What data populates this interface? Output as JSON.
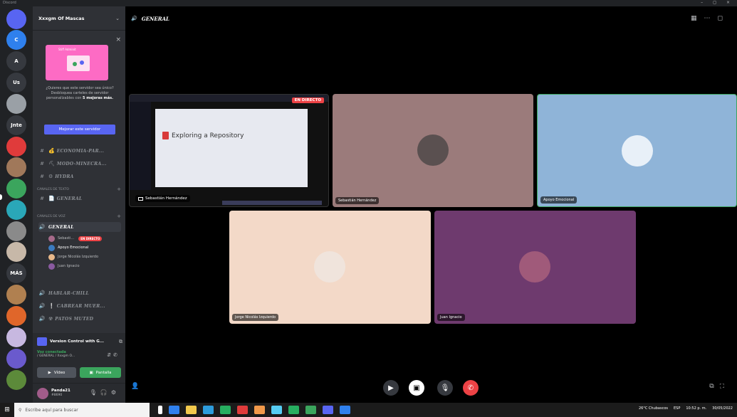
{
  "window": {
    "app_title": "Discord",
    "controls": "– ◻ ×"
  },
  "server_rail": {
    "items": [
      {
        "label": "",
        "color": "#5865f2"
      },
      {
        "label": "C",
        "color": "#2f80ed"
      },
      {
        "label": "A",
        "color": "#36393f"
      },
      {
        "label": "Us",
        "color": "#36393f"
      },
      {
        "label": "",
        "color": "#9aa0a6"
      },
      {
        "label": "Jnte",
        "color": "#36393f"
      },
      {
        "label": "",
        "color": "#e03b3b"
      },
      {
        "label": "",
        "color": "#a0785a"
      },
      {
        "label": "",
        "color": "#3ba55d"
      },
      {
        "label": "",
        "color": "#2aa7b8"
      },
      {
        "label": "",
        "color": "#8a8a8a"
      },
      {
        "label": "",
        "color": "#c7b8a8"
      },
      {
        "label": "MÁS",
        "color": "#36393f"
      },
      {
        "label": "",
        "color": "#b08050"
      },
      {
        "label": "",
        "color": "#e0662a"
      },
      {
        "label": "",
        "color": "#c7b8e0"
      },
      {
        "label": "",
        "color": "#6a5acd"
      },
      {
        "label": "",
        "color": "#5c8a3a"
      }
    ]
  },
  "sidebar": {
    "server_name": "Xxxgm Of Mascas",
    "promo": {
      "card_label": "Stiff Adminit",
      "text_pre": "¿Quieres que este servidor sea único? Desbloquea carteles de servidor personalizables con",
      "text_bold": "5 mejoras más.",
      "button": "Mejorar este servidor"
    },
    "channels_top": [
      {
        "icon": "#",
        "emoji": "💰",
        "label": "ECONOMIA-PAR..."
      },
      {
        "icon": "#",
        "emoji": "⛏",
        "label": "MODO-MINECRA..."
      },
      {
        "icon": "#",
        "emoji": "⚙",
        "label": "HYDRA"
      }
    ],
    "cat_text": "CANALES DE TEXTO",
    "text_channel": {
      "icon": "#",
      "emoji": "📄",
      "label": "GENERAL"
    },
    "cat_voice": "CANALES DE VOZ",
    "voice_general": "GENERAL",
    "voice_users": [
      {
        "name": "Sebasti...",
        "live": "EN DIRECTO",
        "color": "#a66a8a"
      },
      {
        "name": "Apoyo Emocional",
        "live": "",
        "color": "#3b7bbf"
      },
      {
        "name": "Jorge Nicolás Izquierdo",
        "live": "",
        "color": "#e8b88a"
      },
      {
        "name": "Juan Ignacio",
        "live": "",
        "color": "#8a5aa0"
      }
    ],
    "voice_others": [
      {
        "label": "HABLAR-CHILL",
        "emoji": ""
      },
      {
        "label": "CABREAR MUER...",
        "emoji": "❕"
      },
      {
        "label": "PATOS MUTED",
        "emoji": "☢"
      }
    ]
  },
  "stream_panel": {
    "title": "Version Control with G...",
    "status": "Voz conectada",
    "path": "/ GENERAL / Xxxgm O...",
    "video": "Vídeo",
    "screen": "Pantalla"
  },
  "user_panel": {
    "name": "Panda21",
    "tag": "#8690"
  },
  "main": {
    "channel_title": "GENERAL",
    "tiles": {
      "stream": {
        "live": "EN DIRECTO",
        "slide_title": "Exploring a Repository",
        "name": "Sebastián Hernández"
      },
      "sebastian": {
        "name": "Sebastián Hernández",
        "bg": "#9b7b7b"
      },
      "apoyo": {
        "name": "Apoyo Emocional",
        "bg": "#8fb4d8"
      },
      "jorge": {
        "name": "Jorge Nicolás Izquierdo",
        "bg": "#f3d9c8"
      },
      "juan": {
        "name": "Juan Ignacio",
        "bg": "#6e3a6e"
      }
    }
  },
  "taskbar": {
    "search": "Escribe aquí para buscar",
    "weather": "26°C Chubascos",
    "lang": "ESP",
    "time": "10:52 p. m.",
    "date": "30/05/2022"
  }
}
